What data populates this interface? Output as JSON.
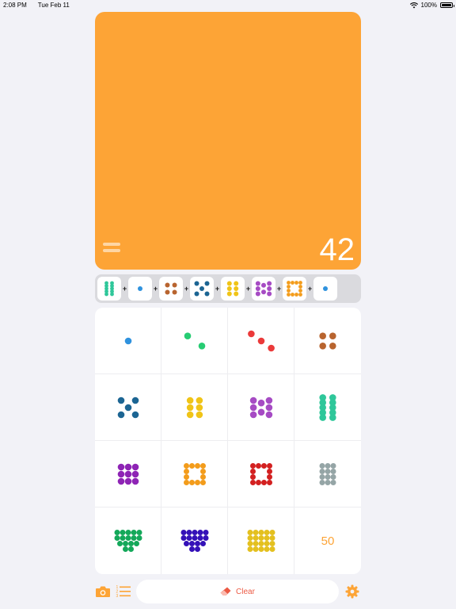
{
  "status_bar": {
    "time": "2:08 PM",
    "date": "Tue Feb 11",
    "battery": "100%"
  },
  "display": {
    "total": "42"
  },
  "expression": [
    {
      "value": 10,
      "color": "#2fc79a"
    },
    {
      "value": 1,
      "color": "#2f92de"
    },
    {
      "value": 4,
      "color": "#b8642f"
    },
    {
      "value": 5,
      "color": "#1c6593"
    },
    {
      "value": 6,
      "color": "#f0c417"
    },
    {
      "value": 8,
      "color": "#a64bc4"
    },
    {
      "value": 12,
      "color": "#f39c1b",
      "outline": true
    },
    {
      "value": 1,
      "color": "#2f92de"
    }
  ],
  "operator": "+",
  "grid": [
    {
      "value": 1,
      "color": "#2f92de"
    },
    {
      "value": 2,
      "color": "#27cc73"
    },
    {
      "value": 3,
      "color": "#eb3a3a"
    },
    {
      "value": 4,
      "color": "#b8642f"
    },
    {
      "value": 5,
      "color": "#1c6593"
    },
    {
      "value": 6,
      "color": "#f0c417"
    },
    {
      "value": 8,
      "color": "#a64bc4"
    },
    {
      "value": 10,
      "color": "#2fc79a"
    },
    {
      "value": 9,
      "color": "#8e24b5"
    },
    {
      "value": 12,
      "color": "#f39c1b",
      "outline": true
    },
    {
      "value": 12,
      "color": "#d32020",
      "outline": true
    },
    {
      "value": 12,
      "color": "#95a5a6"
    },
    {
      "value": 16,
      "color": "#14a85a"
    },
    {
      "value": 16,
      "color": "#3411b8"
    },
    {
      "value": 20,
      "color": "#e4c01f"
    },
    {
      "value": 50,
      "label": "50",
      "color": "#fda436"
    }
  ],
  "toolbar": {
    "clear_label": "Clear"
  },
  "colors": {
    "accent": "#fda436",
    "clear": "#ec5a44",
    "background": "#f2f2f7"
  }
}
